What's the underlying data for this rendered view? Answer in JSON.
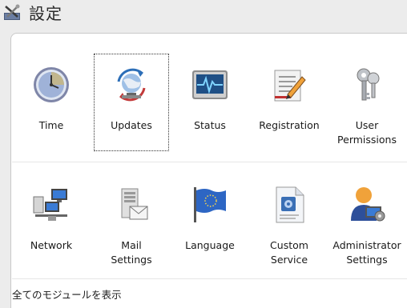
{
  "window": {
    "title": "設定",
    "title_icon": "tools-icon"
  },
  "modules": [
    {
      "label": "Time",
      "icon": "clock-icon",
      "selected": false
    },
    {
      "label": "Updates",
      "icon": "globe-update-icon",
      "selected": true
    },
    {
      "label": "Status",
      "icon": "monitor-heartbeat-icon",
      "selected": false
    },
    {
      "label": "Registration",
      "icon": "document-pencil-icon",
      "selected": false
    },
    {
      "label": "User\nPermissions",
      "icon": "keys-icon",
      "selected": false
    },
    {
      "label": "Network",
      "icon": "network-computers-icon",
      "selected": false
    },
    {
      "label": "Mail\nSettings",
      "icon": "mail-server-icon",
      "selected": false
    },
    {
      "label": "Language",
      "icon": "flag-icon",
      "selected": false
    },
    {
      "label": "Custom\nService",
      "icon": "custom-document-icon",
      "selected": false
    },
    {
      "label": "Administrator\nSettings",
      "icon": "admin-user-icon",
      "selected": false
    }
  ],
  "footer": {
    "show_all_label": "全てのモジュールを表示"
  }
}
